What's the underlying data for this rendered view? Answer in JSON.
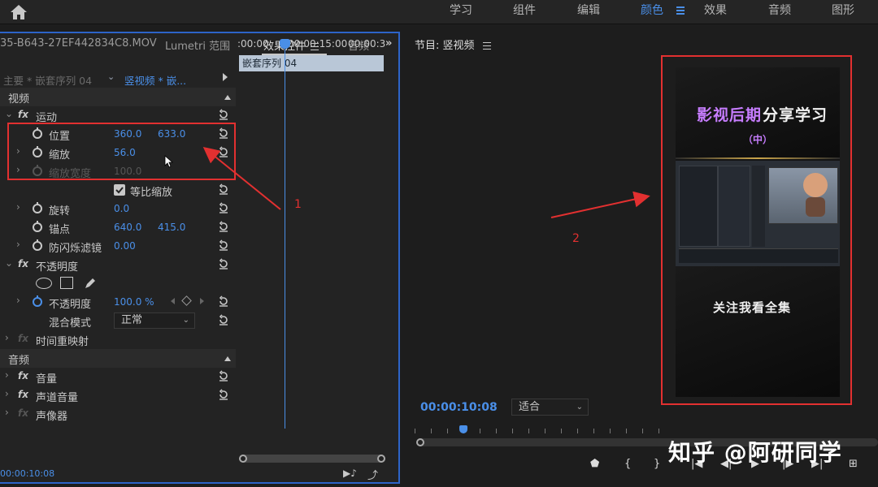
{
  "workspaces": [
    "学习",
    "组件",
    "编辑",
    "颜色",
    "效果",
    "音频",
    "图形"
  ],
  "active_workspace": "颜色",
  "left_panel": {
    "tabs": [
      "35-B643-27EF442834C8.MOV",
      "Lumetri 范围",
      "效果控件",
      "音频"
    ],
    "active_tab": "效果控件",
    "master": "主要 * 嵌套序列 04",
    "sequence": "竖视频 * 嵌...",
    "video_header": "视频",
    "motion": "运动",
    "position_label": "位置",
    "position_x": "360.0",
    "position_y": "633.0",
    "scale_label": "缩放",
    "scale_value": "56.0",
    "scale_width_label": "缩放宽度",
    "scale_width_value": "100.0",
    "uniform_scale": "等比缩放",
    "rotation_label": "旋转",
    "rotation_value": "0.0",
    "anchor_label": "锚点",
    "anchor_x": "640.0",
    "anchor_y": "415.0",
    "flicker_label": "防闪烁滤镜",
    "flicker_value": "0.00",
    "opacity": "不透明度",
    "opacity_label": "不透明度",
    "opacity_value": "100.0 %",
    "blend_label": "混合模式",
    "blend_value": "正常",
    "time_remap": "时间重映射",
    "audio_header": "音频",
    "volume": "音量",
    "channel_volume": "声道音量",
    "panner": "声像器",
    "timecode": "00:00:10:08"
  },
  "timeline": {
    "ticks": [
      ":00:00",
      "00:00:15:00",
      "00:00:3"
    ],
    "clip": "嵌套序列 04"
  },
  "program": {
    "title": "节目: 竖视频",
    "timecode": "00:00:10:08",
    "fit": "适合",
    "preview_title_a": "影视后期",
    "preview_title_b": "分享学习",
    "preview_sub": "（中）",
    "preview_bottom": "关注我看全集"
  },
  "annotations": {
    "one": "1",
    "two": "2"
  },
  "watermark": "知乎 @阿研同学",
  "colors": {
    "accent": "#4a8fe8",
    "highlight": "#e23030"
  }
}
